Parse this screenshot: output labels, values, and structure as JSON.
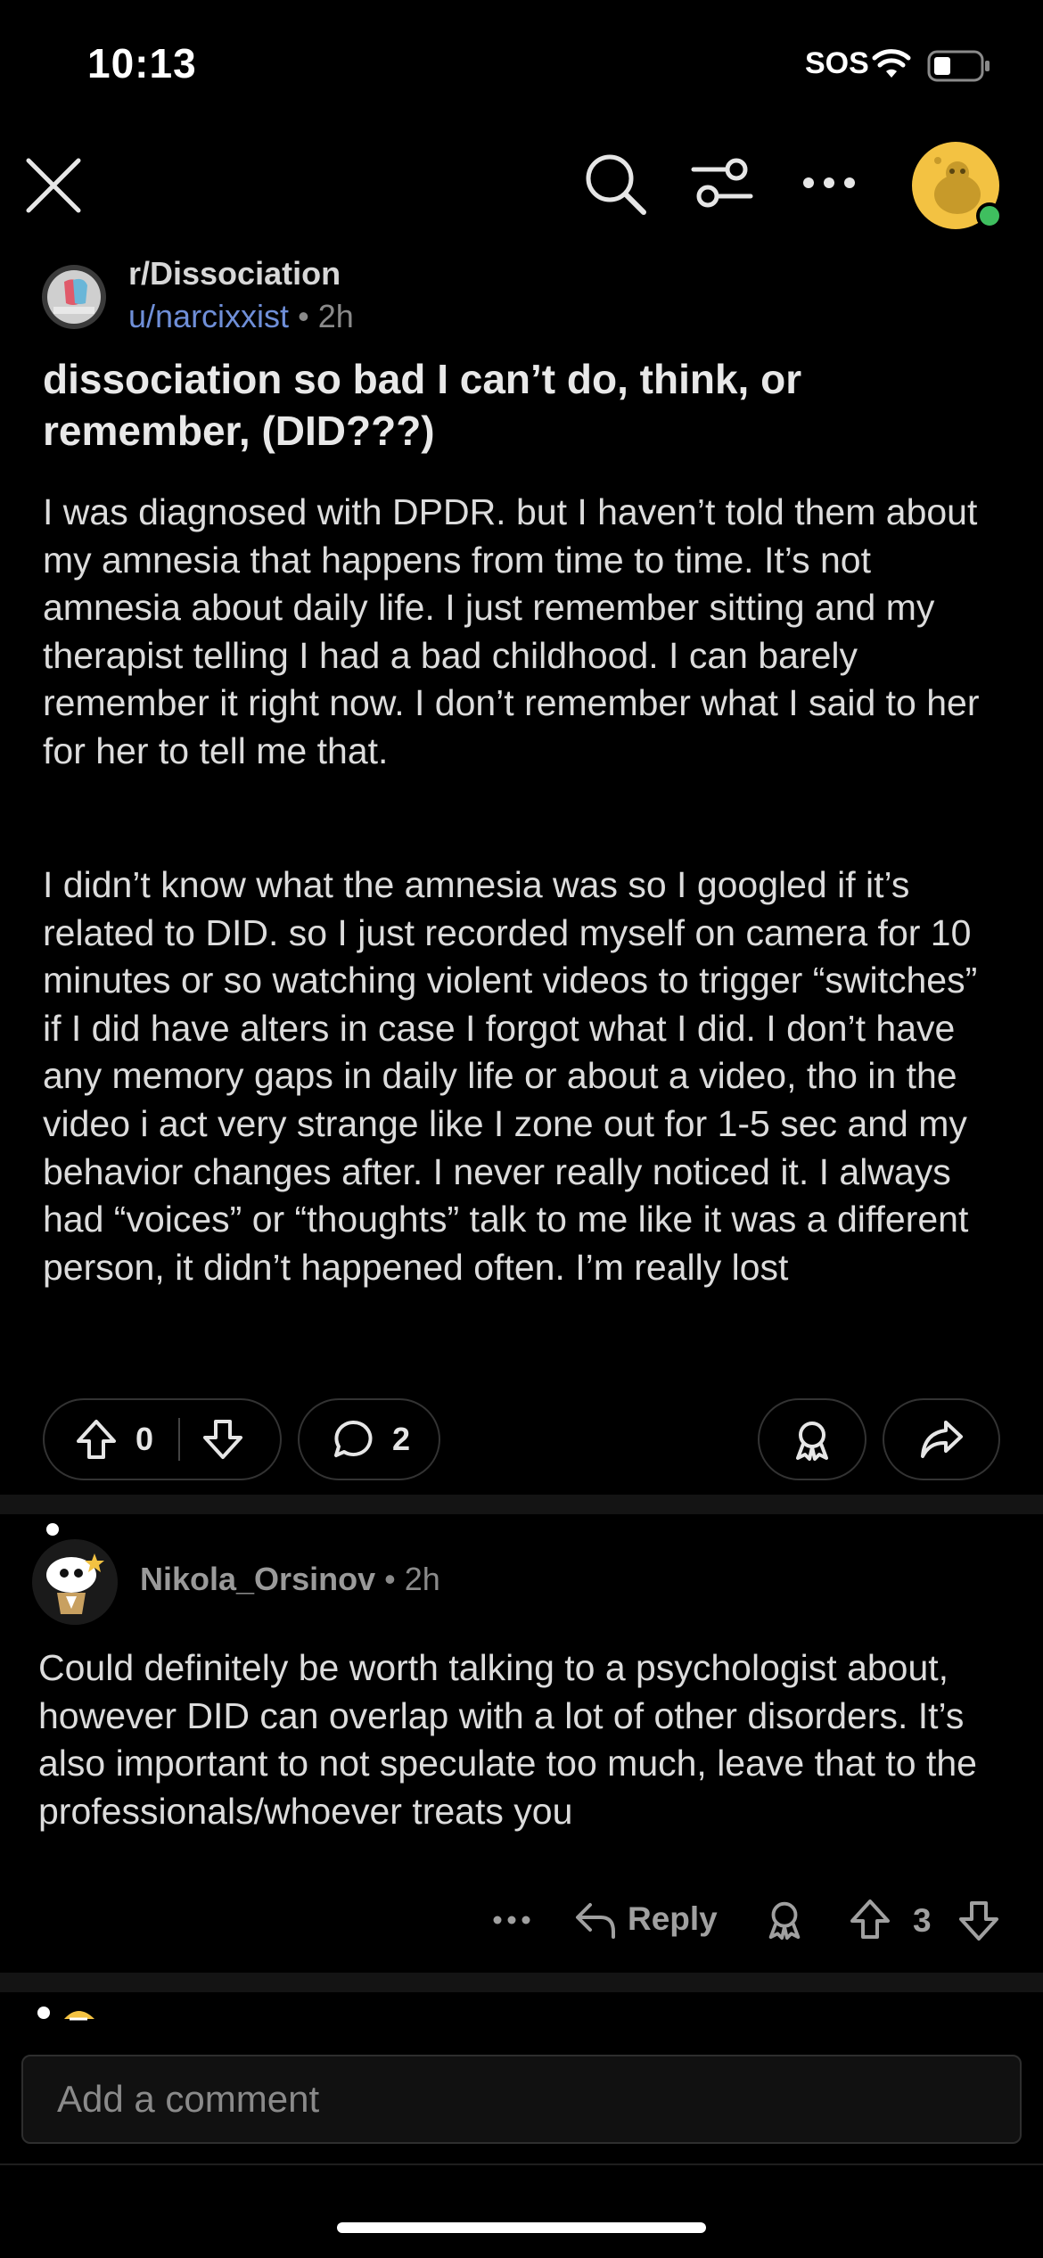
{
  "status_bar": {
    "time": "10:13",
    "sos": "SOS"
  },
  "post": {
    "subreddit": "r/Dissociation",
    "author": "u/narcixxist",
    "separator": "•",
    "age": "2h",
    "title": "dissociation so bad I can’t do, think, or remember, (DID???)",
    "body_p1": "I was diagnosed with DPDR. but I haven’t told them about my amnesia that happens from time to time. It’s not amnesia about daily life. I just remember sitting and my therapist telling I had a bad childhood. I can barely remember it right now. I don’t remember what I said to her for her to tell me that.",
    "body_p2": "I didn’t know what the amnesia was so I googled if it’s related to DID. so I just recorded myself on camera for 10 minutes or so watching violent videos to trigger “switches” if I did have alters in case I forgot what I did. I don’t have any memory gaps in daily life or about a video, tho in the video i act very strange like I zone out for 1-5 sec and my behavior changes after. I never really noticed it. I always had “voices” or “thoughts” talk to me like it was a different person, it didn’t happened often. I’m really lost",
    "vote_count": "0",
    "comment_count": "2"
  },
  "comment": {
    "author": "Nikola_Orsinov",
    "separator": "•",
    "age": "2h",
    "text": "Could definitely be worth talking to a psychologist about, however DID can overlap with a lot of other disorders. It’s also important to not speculate too much, leave that to the professionals/whoever treats you",
    "reply_label": "Reply",
    "vote_count": "3"
  },
  "composer": {
    "placeholder": "Add a comment"
  },
  "icons": {
    "close": "close-icon",
    "search": "search-icon",
    "filter": "filter-icon",
    "more": "more-icon",
    "avatar": "user-avatar",
    "upvote": "upvote-icon",
    "downvote": "downvote-icon",
    "comment": "comment-icon",
    "award": "award-icon",
    "share": "share-icon",
    "reply": "reply-icon"
  },
  "colors": {
    "background": "#000000",
    "link_blue": "#6f8fd8",
    "online_green": "#3fbf5f",
    "avatar_yellow": "#f3c242"
  }
}
